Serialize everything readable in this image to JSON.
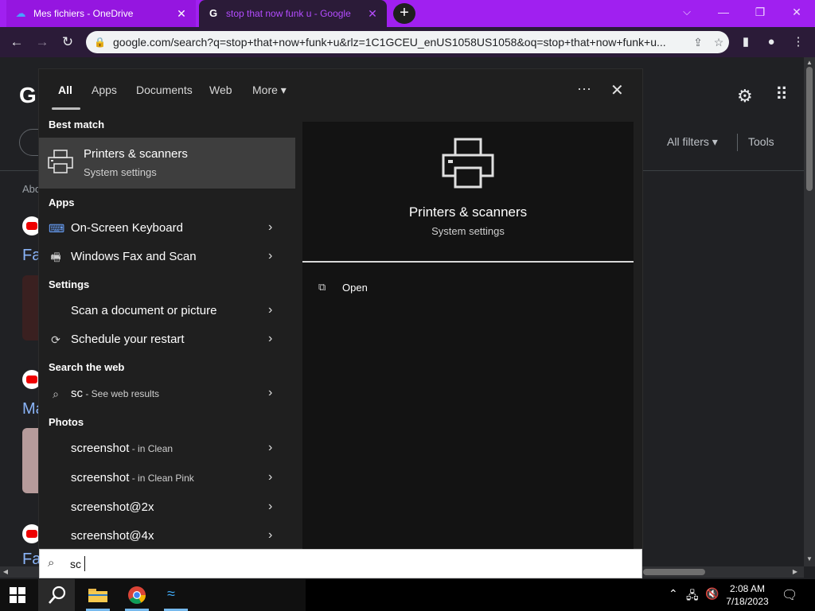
{
  "browser": {
    "tabs": [
      {
        "title": "Mes fichiers - OneDrive",
        "close": "✕"
      },
      {
        "title": "stop that now funk u - Google",
        "close": "✕"
      }
    ],
    "new_tab": "+",
    "url": "google.com/search?q=stop+that+now+funk+u&rlz=1C1GCEU_enUS1058US1058&oq=stop+that+now+funk+u..."
  },
  "google": {
    "logo": "G",
    "all_filters": "All filters ▾",
    "tools": "Tools",
    "about": "Abo",
    "results": [
      {
        "title": "Fa"
      },
      {
        "title": "Ma"
      },
      {
        "title": "Fa"
      }
    ]
  },
  "search_panel": {
    "tabs": {
      "all": "All",
      "apps": "Apps",
      "documents": "Documents",
      "web": "Web",
      "more": "More ▾"
    },
    "more_options": "···",
    "close": "✕",
    "best_match_header": "Best match",
    "best_match": {
      "title": "Printers & scanners",
      "subtitle": "System settings"
    },
    "apps_header": "Apps",
    "apps": [
      "On-Screen Keyboard",
      "Windows Fax and Scan"
    ],
    "settings_header": "Settings",
    "settings": [
      "Scan a document or picture",
      "Schedule your restart"
    ],
    "web_header": "Search the web",
    "web": {
      "query": "sc",
      "hint": " - See web results"
    },
    "photos_header": "Photos",
    "photos": [
      {
        "name": "screenshot",
        "hint": " - in Clean"
      },
      {
        "name": "screenshot",
        "hint": " - in Clean Pink"
      },
      {
        "name": "screenshot@2x",
        "hint": ""
      },
      {
        "name": "screenshot@4x",
        "hint": ""
      }
    ],
    "chevron": "›",
    "preview": {
      "title": "Printers & scanners",
      "subtitle": "System settings",
      "open": "Open"
    }
  },
  "search_box": {
    "value": "sc"
  },
  "taskbar": {
    "time": "2:08 AM",
    "date": "7/18/2023"
  },
  "colors": {
    "accent_purple": "#a020f0",
    "panel_bg": "#1f1f1f",
    "highlight": "#3e3e3e"
  }
}
